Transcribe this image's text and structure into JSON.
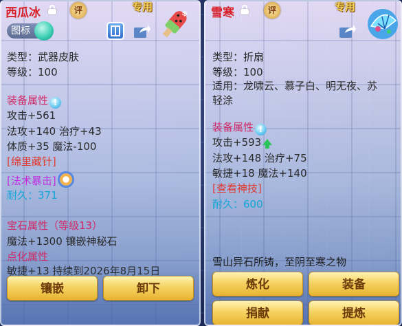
{
  "left_panel": {
    "item_name": "西瓜冰",
    "rating_badge": "评",
    "exclusive_label": "专用",
    "tag_toggle_label": "图标",
    "type_line": "类型：武器皮肤",
    "level_line": "等级：100",
    "equip_attr_title": "装备属性",
    "attack_line": "攻击+561",
    "magic_heal_line": "法攻+140 治疗+43",
    "constitution_magic_line": "体质+35 魔法-100",
    "special_tag_1": "[绵里藏针]",
    "special_tag_2": "[法术暴击]",
    "durability_line": "耐久：371",
    "gem_attr_title": "宝石属性（等级13）",
    "gem_line": "魔法+1300 镶嵌神秘石",
    "enchant_title": "点化属性",
    "enchant_line": "敏捷+13 持续到2026年8月15日",
    "buttons": {
      "inlay": "镶嵌",
      "unequip": "卸下"
    }
  },
  "right_panel": {
    "item_name": "雪寒",
    "rating_badge": "评",
    "exclusive_label": "专用",
    "type_line": "类型：折扇",
    "level_line": "等级：100",
    "applicable_line_1": "适用：龙啸云、慕子白、明无夜、苏",
    "applicable_line_2": "轻涂",
    "equip_attr_title": "装备属性",
    "attack_line": "攻击+593",
    "magic_heal_line": "法攻+148 治疗+75",
    "agility_magic_line": "敏捷+18 魔法+140",
    "special_tag": "[查看神技]",
    "durability_line": "耐久：600",
    "description": "雪山异石所铸，至阴至寒之物",
    "buttons": {
      "refine": "炼化",
      "equip": "装备",
      "donate": "捐献",
      "extract": "提炼"
    }
  },
  "colors": {
    "accent_red": "#d02a66",
    "button_gold": "#f6d262",
    "durability_cyan": "#12a6d8"
  }
}
